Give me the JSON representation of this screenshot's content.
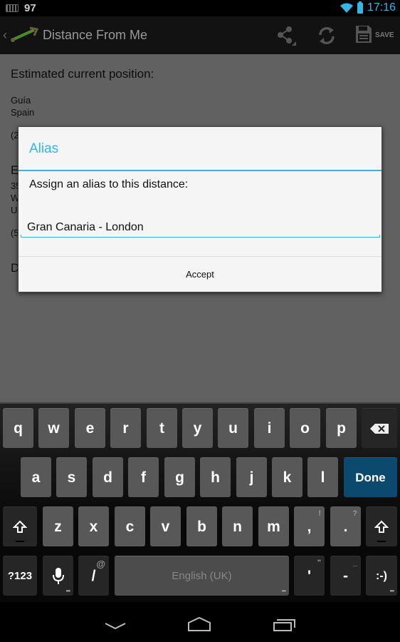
{
  "status_bar": {
    "notification_count": "97",
    "time": "17:16"
  },
  "action_bar": {
    "title": "Distance From Me",
    "save_label": "SAVE"
  },
  "background_content": {
    "estimated_position_heading": "Estimated current position:",
    "location_line1": "Guía",
    "location_line2": "Spain",
    "coords_partial": "(2",
    "second_heading_partial": "E",
    "second_line1_partial": "35",
    "second_line2_partial": "W",
    "second_line3_partial": "U",
    "second_coords_partial": "(5",
    "third_heading_partial": "D"
  },
  "dialog": {
    "title": "Alias",
    "message": "Assign an alias to this distance:",
    "input_value": "Gran Canaria - London",
    "accept_label": "Accept"
  },
  "keyboard": {
    "row1": [
      "q",
      "w",
      "e",
      "r",
      "t",
      "y",
      "u",
      "i",
      "o",
      "p"
    ],
    "row2": [
      "a",
      "s",
      "d",
      "f",
      "g",
      "h",
      "j",
      "k",
      "l"
    ],
    "row3": [
      "z",
      "x",
      "c",
      "v",
      "b",
      "n",
      "m"
    ],
    "comma": ",",
    "comma_hint": "!",
    "period": ".",
    "period_hint": "?",
    "done_label": "Done",
    "symbols_label": "?123",
    "slash": "/",
    "slash_hint": "@",
    "space_label": "English (UK)",
    "apostrophe": "'",
    "apostrophe_hint": "\"",
    "dash": "-",
    "dash_hint": "_",
    "smiley": ":-)"
  },
  "colors": {
    "accent": "#33b5e5",
    "done_key": "#0b4a6e"
  }
}
